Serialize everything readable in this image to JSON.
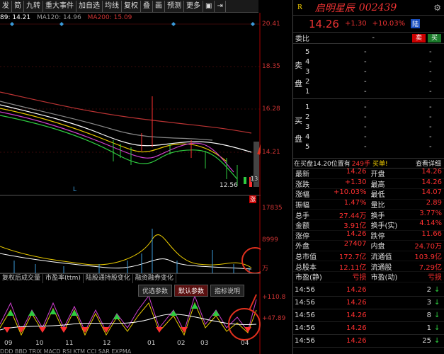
{
  "toolbar": {
    "items": [
      "发",
      "简",
      "九转",
      "重大事件",
      "加自选",
      "均线",
      "复权",
      "叠",
      "画",
      "预测",
      "更多"
    ]
  },
  "ma": {
    "ma60": "89: 14.21",
    "ma120": "MA120: 14.96",
    "ma200": "MA200: 15.09"
  },
  "axis": {
    "p1": "20.41",
    "p2": "18.35",
    "p3": "16.28",
    "p4": "14.21",
    "vol1": "17835",
    "vol2": "8999",
    "vol3": "万",
    "osc1": "+110.8",
    "osc2": "+47.89"
  },
  "chart_labels": {
    "low": "12.56",
    "limit_tag": "涨",
    "current": "13",
    "marker": "L"
  },
  "indicator_tabs": [
    "复权后成交量",
    "市盈率(ttm)",
    "陆股通持股变化",
    "融资融券变化"
  ],
  "sub_tabs": {
    "a": "优选参数",
    "b": "默认参数",
    "c": "指标说明"
  },
  "date_labels": [
    "09",
    "10",
    "11",
    "12",
    "01",
    "02",
    "03",
    "04"
  ],
  "osc_labels": [
    "DDD",
    "BBD",
    "TRIX",
    "MACD",
    "RSI",
    "KTM",
    "CCI",
    "SAR",
    "EXPMA"
  ],
  "stock": {
    "name": "启明星辰",
    "code": "002439",
    "price": "14.26",
    "change": "+1.30",
    "pct": "+10.03%",
    "tag": "陆"
  },
  "weibi": {
    "label": "委比",
    "value": "-",
    "buy": "买",
    "sell": "卖"
  },
  "sell_side": {
    "label1": "卖",
    "label2": "盘",
    "levels": [
      {
        "n": "5",
        "p": "-",
        "v": "-"
      },
      {
        "n": "4",
        "p": "-",
        "v": "-"
      },
      {
        "n": "3",
        "p": "-",
        "v": "-"
      },
      {
        "n": "2",
        "p": "-",
        "v": "-"
      },
      {
        "n": "1",
        "p": "-",
        "v": "-"
      }
    ]
  },
  "buy_side": {
    "label1": "买",
    "label2": "盘",
    "levels": [
      {
        "n": "1",
        "p": "-",
        "v": "-"
      },
      {
        "n": "2",
        "p": "-",
        "v": "-"
      },
      {
        "n": "3",
        "p": "-",
        "v": "-"
      },
      {
        "n": "4",
        "p": "-",
        "v": "-"
      },
      {
        "n": "5",
        "p": "-",
        "v": "-"
      }
    ]
  },
  "notice": {
    "text": "在买盘14.20位置有",
    "qty": "249手",
    "tail": "买单!",
    "link": "查看详细"
  },
  "stats": [
    {
      "k1": "最新",
      "v1": "14.26",
      "k2": "开盘",
      "v2": "14.26"
    },
    {
      "k1": "涨跌",
      "v1": "+1.30",
      "k2": "最高",
      "v2": "14.26"
    },
    {
      "k1": "涨幅",
      "v1": "+10.03%",
      "k2": "最低",
      "v2": "14.07"
    },
    {
      "k1": "振幅",
      "v1": "1.47%",
      "k2": "量比",
      "v2": "2.89"
    },
    {
      "k1": "总手",
      "v1": "27.44万",
      "k2": "换手",
      "v2": "3.77%"
    },
    {
      "k1": "金额",
      "v1": "3.91亿",
      "k2": "换手(实)",
      "v2": "4.14%"
    },
    {
      "k1": "涨停",
      "v1": "14.26",
      "k2": "跌停",
      "v2": "11.66"
    },
    {
      "k1": "外盘",
      "v1": "27407",
      "k2": "内盘",
      "v2": "24.70万"
    },
    {
      "k1": "总市值",
      "v1": "172.7亿",
      "k2": "流通值",
      "v2": "103.9亿"
    },
    {
      "k1": "总股本",
      "v1": "12.11亿",
      "k2": "流通股",
      "v2": "7.29亿"
    },
    {
      "k1": "市盈(静)",
      "v1": "亏损",
      "k2": "市盈(动)",
      "v2": "亏损"
    }
  ],
  "trades": [
    {
      "t": "14:56",
      "p": "14.26",
      "v": "2"
    },
    {
      "t": "14:56",
      "p": "14.26",
      "v": "3"
    },
    {
      "t": "14:56",
      "p": "14.26",
      "v": "8"
    },
    {
      "t": "14:56",
      "p": "14.26",
      "v": "1"
    },
    {
      "t": "14:56",
      "p": "14.26",
      "v": "25"
    }
  ],
  "colors": {
    "up": "#ff3030",
    "down": "#2ecc40",
    "arrow": "#e0301e"
  }
}
